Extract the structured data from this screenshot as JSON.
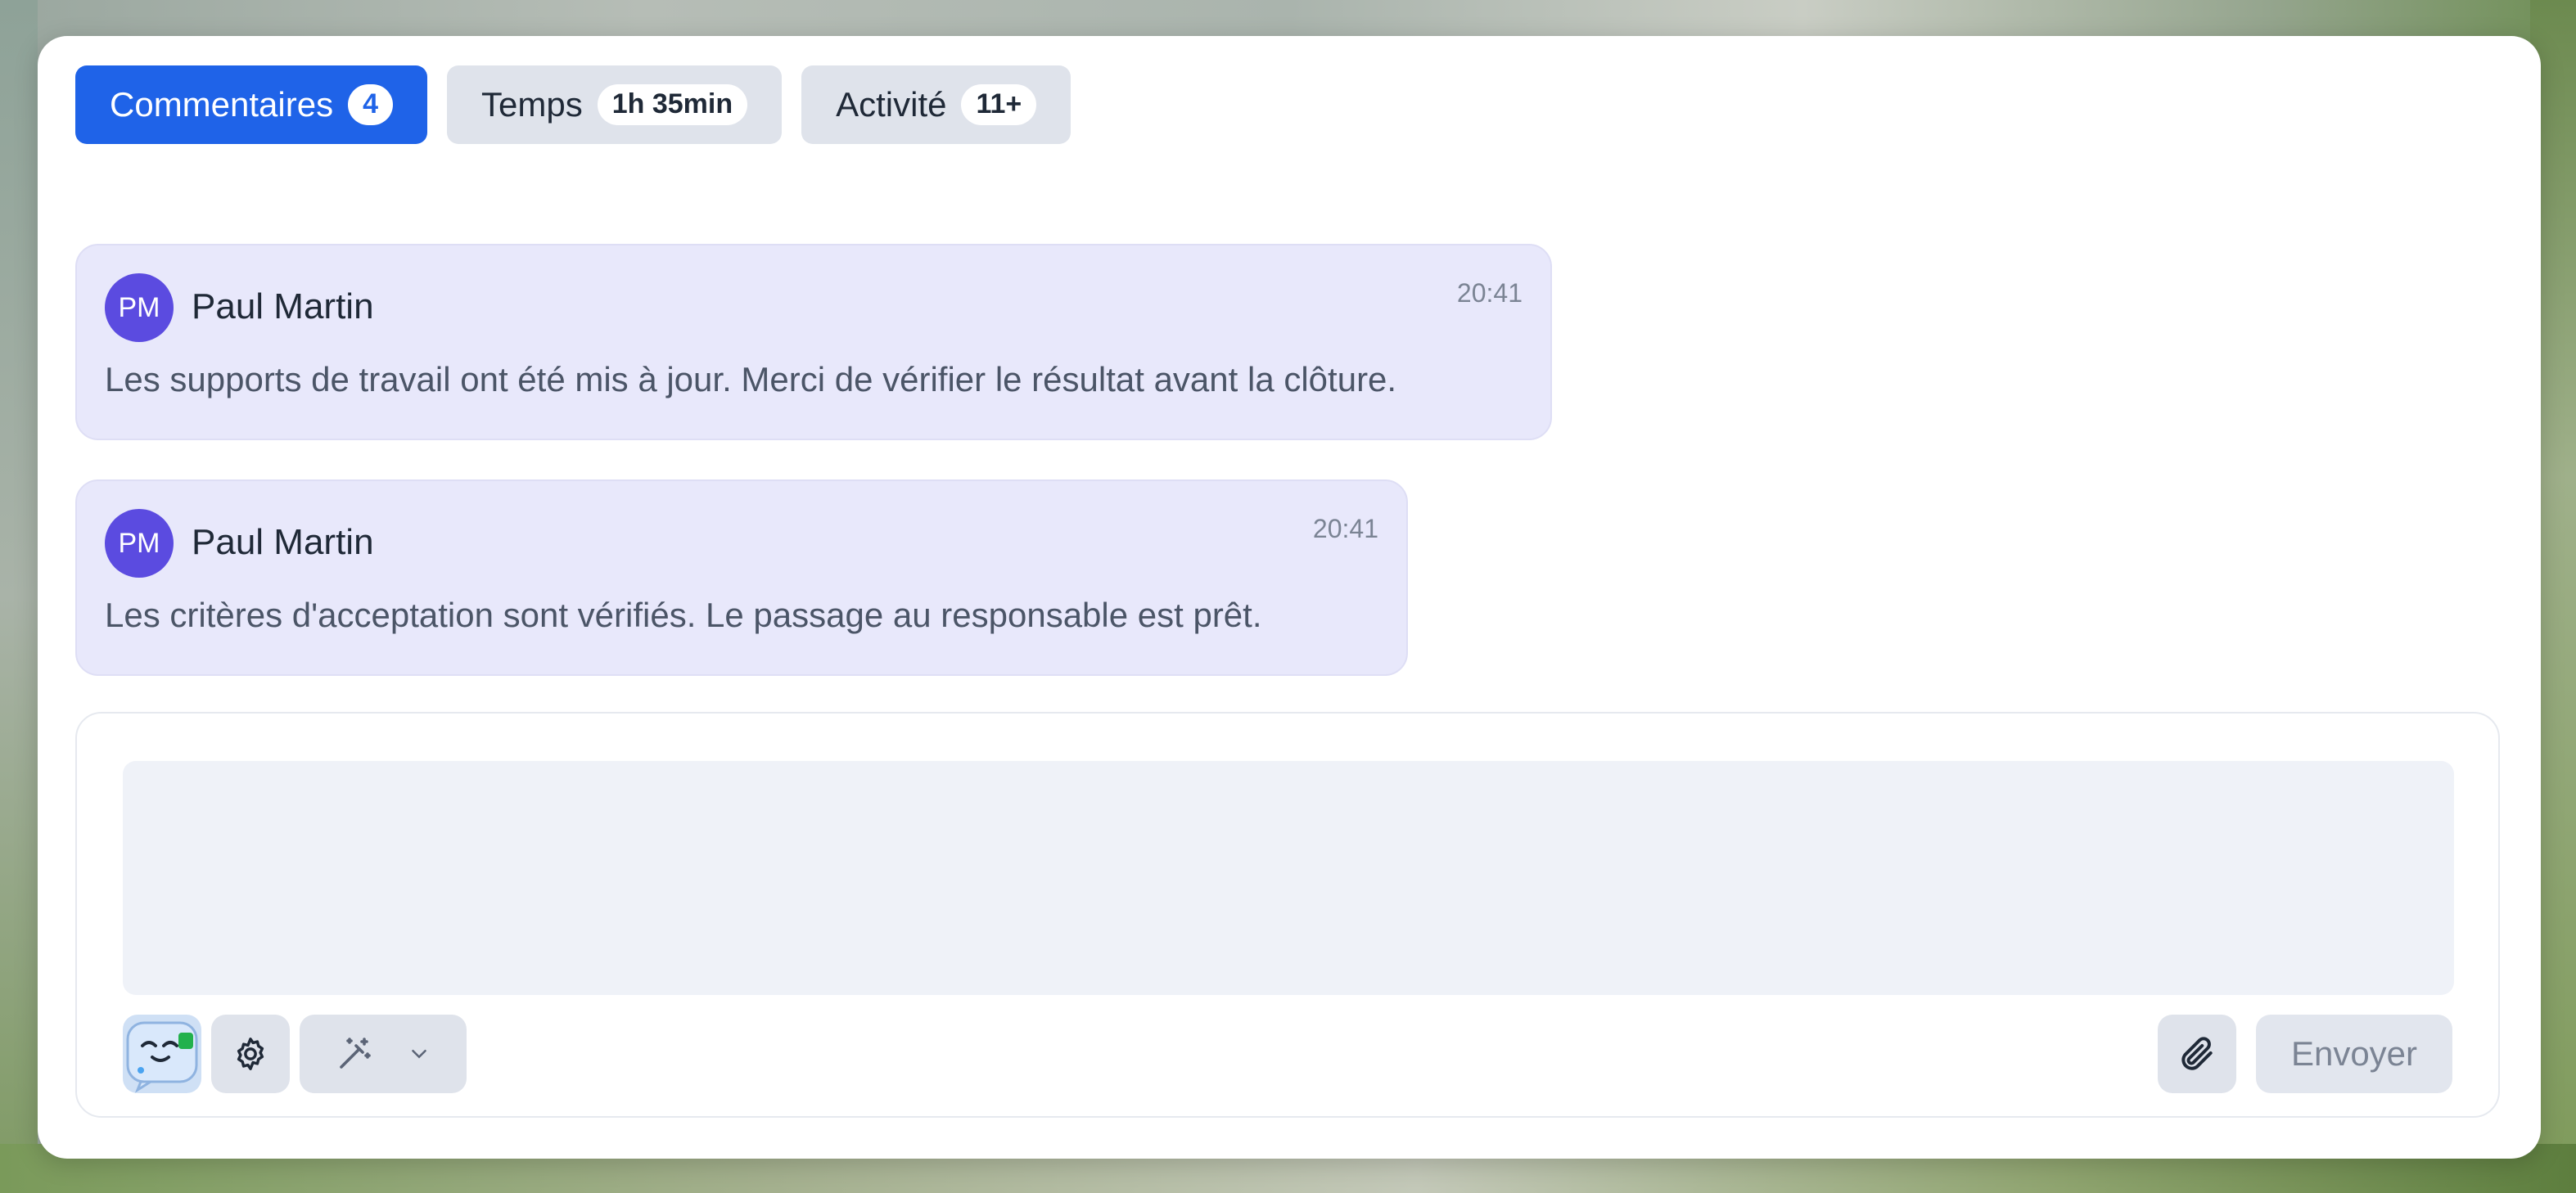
{
  "tabs": [
    {
      "label": "Commentaires",
      "badge": "4",
      "active": true
    },
    {
      "label": "Temps",
      "badge": "1h 35min",
      "active": false
    },
    {
      "label": "Activité",
      "badge": "11+",
      "active": false
    }
  ],
  "comments": [
    {
      "initials": "PM",
      "author": "Paul Martin",
      "time": "20:41",
      "text": "Les supports de travail ont été mis à jour. Merci de vérifier le résultat avant la clôture."
    },
    {
      "initials": "PM",
      "author": "Paul Martin",
      "time": "20:41",
      "text": "Les critères d'acceptation sont vérifiés. Le passage au responsable est prêt."
    }
  ],
  "composer": {
    "value": "",
    "send_label": "Envoyer"
  },
  "icons": {
    "bot": "bot-assistant-icon",
    "settings": "gear-icon",
    "ai": "magic-wand-icon",
    "dropdown": "chevron-down-icon",
    "attach": "paperclip-icon"
  },
  "colors": {
    "accent": "#1f63e8",
    "avatar": "#5b4be0",
    "comment_bg": "#e8e8fb"
  }
}
